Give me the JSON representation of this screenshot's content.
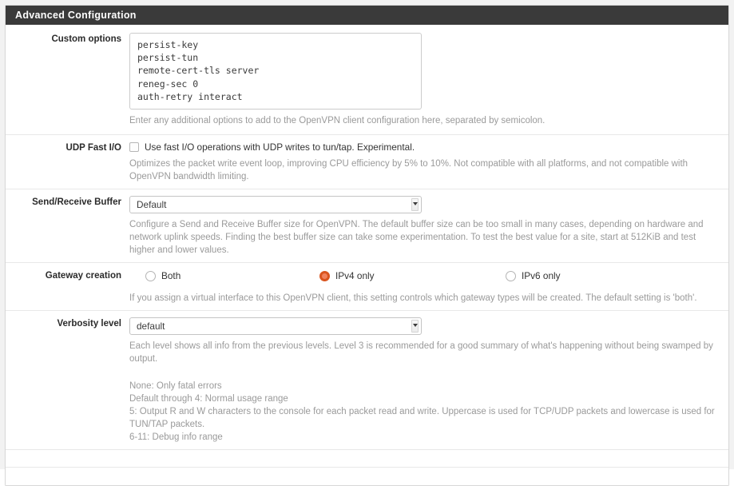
{
  "panel": {
    "title": "Advanced Configuration"
  },
  "rows": {
    "custom_options": {
      "label": "Custom options",
      "textarea_value": "persist-key\npersist-tun\nremote-cert-tls server\nreneg-sec 0\nauth-retry interact",
      "help": "Enter any additional options to add to the OpenVPN client configuration here, separated by semicolon."
    },
    "udp_fast_io": {
      "label": "UDP Fast I/O",
      "checkbox_label": "Use fast I/O operations with UDP writes to tun/tap. Experimental.",
      "checked": false,
      "help": "Optimizes the packet write event loop, improving CPU efficiency by 5% to 10%. Not compatible with all platforms, and not compatible with OpenVPN bandwidth limiting."
    },
    "send_receive_buffer": {
      "label": "Send/Receive Buffer",
      "selected": "Default",
      "options": [
        "Default"
      ],
      "help": "Configure a Send and Receive Buffer size for OpenVPN. The default buffer size can be too small in many cases, depending on hardware and network uplink speeds. Finding the best buffer size can take some experimentation. To test the best value for a site, start at 512KiB and test higher and lower values."
    },
    "gateway_creation": {
      "label": "Gateway creation",
      "options": [
        {
          "label": "Both",
          "checked": false
        },
        {
          "label": "IPv4 only",
          "checked": true
        },
        {
          "label": "IPv6 only",
          "checked": false
        }
      ],
      "help": "If you assign a virtual interface to this OpenVPN client, this setting controls which gateway types will be created. The default setting is 'both'."
    },
    "verbosity_level": {
      "label": "Verbosity level",
      "selected": "default",
      "options": [
        "default"
      ],
      "help": "Each level shows all info from the previous levels. Level 3 is recommended for a good summary of what's happening without being swamped by output.",
      "help_lines": [
        "None: Only fatal errors",
        "Default through 4: Normal usage range",
        "5: Output R and W characters to the console for each packet read and write. Uppercase is used for TCP/UDP packets and lowercase is used for TUN/TAP packets.",
        "6-11: Debug info range"
      ]
    }
  },
  "colors": {
    "header_bg": "#3a3a3a",
    "accent_radio": "#d9541e",
    "help_text": "#9a9a9a",
    "page_bg": "#f2f2f2"
  }
}
